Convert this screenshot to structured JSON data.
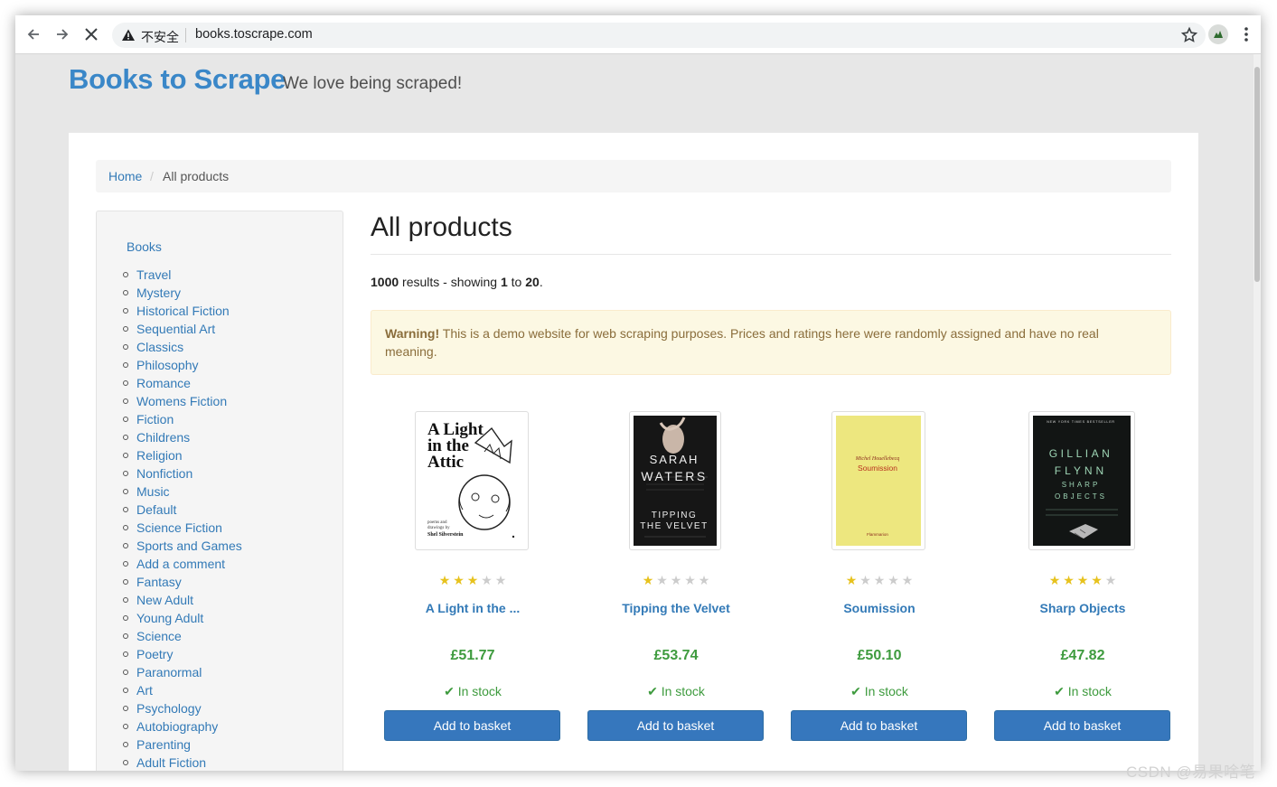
{
  "browser": {
    "security_label": "不安全",
    "url": "books.toscrape.com"
  },
  "header": {
    "brand": "Books to Scrape",
    "tagline": "We love being scraped!"
  },
  "breadcrumb": {
    "home": "Home",
    "separator": "/",
    "current": "All products"
  },
  "sidebar": {
    "title": "Books",
    "categories": [
      "Travel",
      "Mystery",
      "Historical Fiction",
      "Sequential Art",
      "Classics",
      "Philosophy",
      "Romance",
      "Womens Fiction",
      "Fiction",
      "Childrens",
      "Religion",
      "Nonfiction",
      "Music",
      "Default",
      "Science Fiction",
      "Sports and Games",
      "Add a comment",
      "Fantasy",
      "New Adult",
      "Young Adult",
      "Science",
      "Poetry",
      "Paranormal",
      "Art",
      "Psychology",
      "Autobiography",
      "Parenting",
      "Adult Fiction"
    ]
  },
  "main": {
    "heading": "All products",
    "results": {
      "count": "1000",
      "text1": " results - showing ",
      "from": "1",
      "text2": " to ",
      "to": "20",
      "text3": "."
    },
    "alert": {
      "strong": "Warning!",
      "text": " This is a demo website for web scraping purposes. Prices and ratings here were randomly assigned and have no real meaning."
    }
  },
  "products": [
    {
      "title": "A Light in the ...",
      "price": "£51.77",
      "rating": 3,
      "stock": "In stock",
      "button": "Add to basket",
      "cover": {
        "line1": "A Light",
        "line2": "in the",
        "line3": "Attic",
        "small1": "poems and",
        "small2": "drawings by",
        "author": "Shel Silverstein"
      }
    },
    {
      "title": "Tipping the Velvet",
      "price": "£53.74",
      "rating": 1,
      "stock": "In stock",
      "button": "Add to basket",
      "cover": {
        "line1": "SARAH",
        "line2": "WATERS",
        "line3": "TIPPING",
        "line4": "THE VELVET"
      }
    },
    {
      "title": "Soumission",
      "price": "£50.10",
      "rating": 1,
      "stock": "In stock",
      "button": "Add to basket",
      "cover": {
        "author": "Michel Houellebecq",
        "title": "Soumission",
        "publisher": "Flammarion"
      }
    },
    {
      "title": "Sharp Objects",
      "price": "£47.82",
      "rating": 4,
      "stock": "In stock",
      "button": "Add to basket",
      "cover": {
        "top": "NEW YORK TIMES BESTSELLER",
        "line1": "GILLIAN",
        "line2": "FLYNN",
        "line3": "SHARP",
        "line4": "OBJECTS"
      }
    }
  ],
  "watermark": "CSDN @易果啥笔",
  "colors": {
    "link": "#337ab7",
    "brand": "#3a87c8",
    "price": "#3e9b3e",
    "button": "#3677bd",
    "star_on": "#e7c21d",
    "star_off": "#cccccc"
  }
}
